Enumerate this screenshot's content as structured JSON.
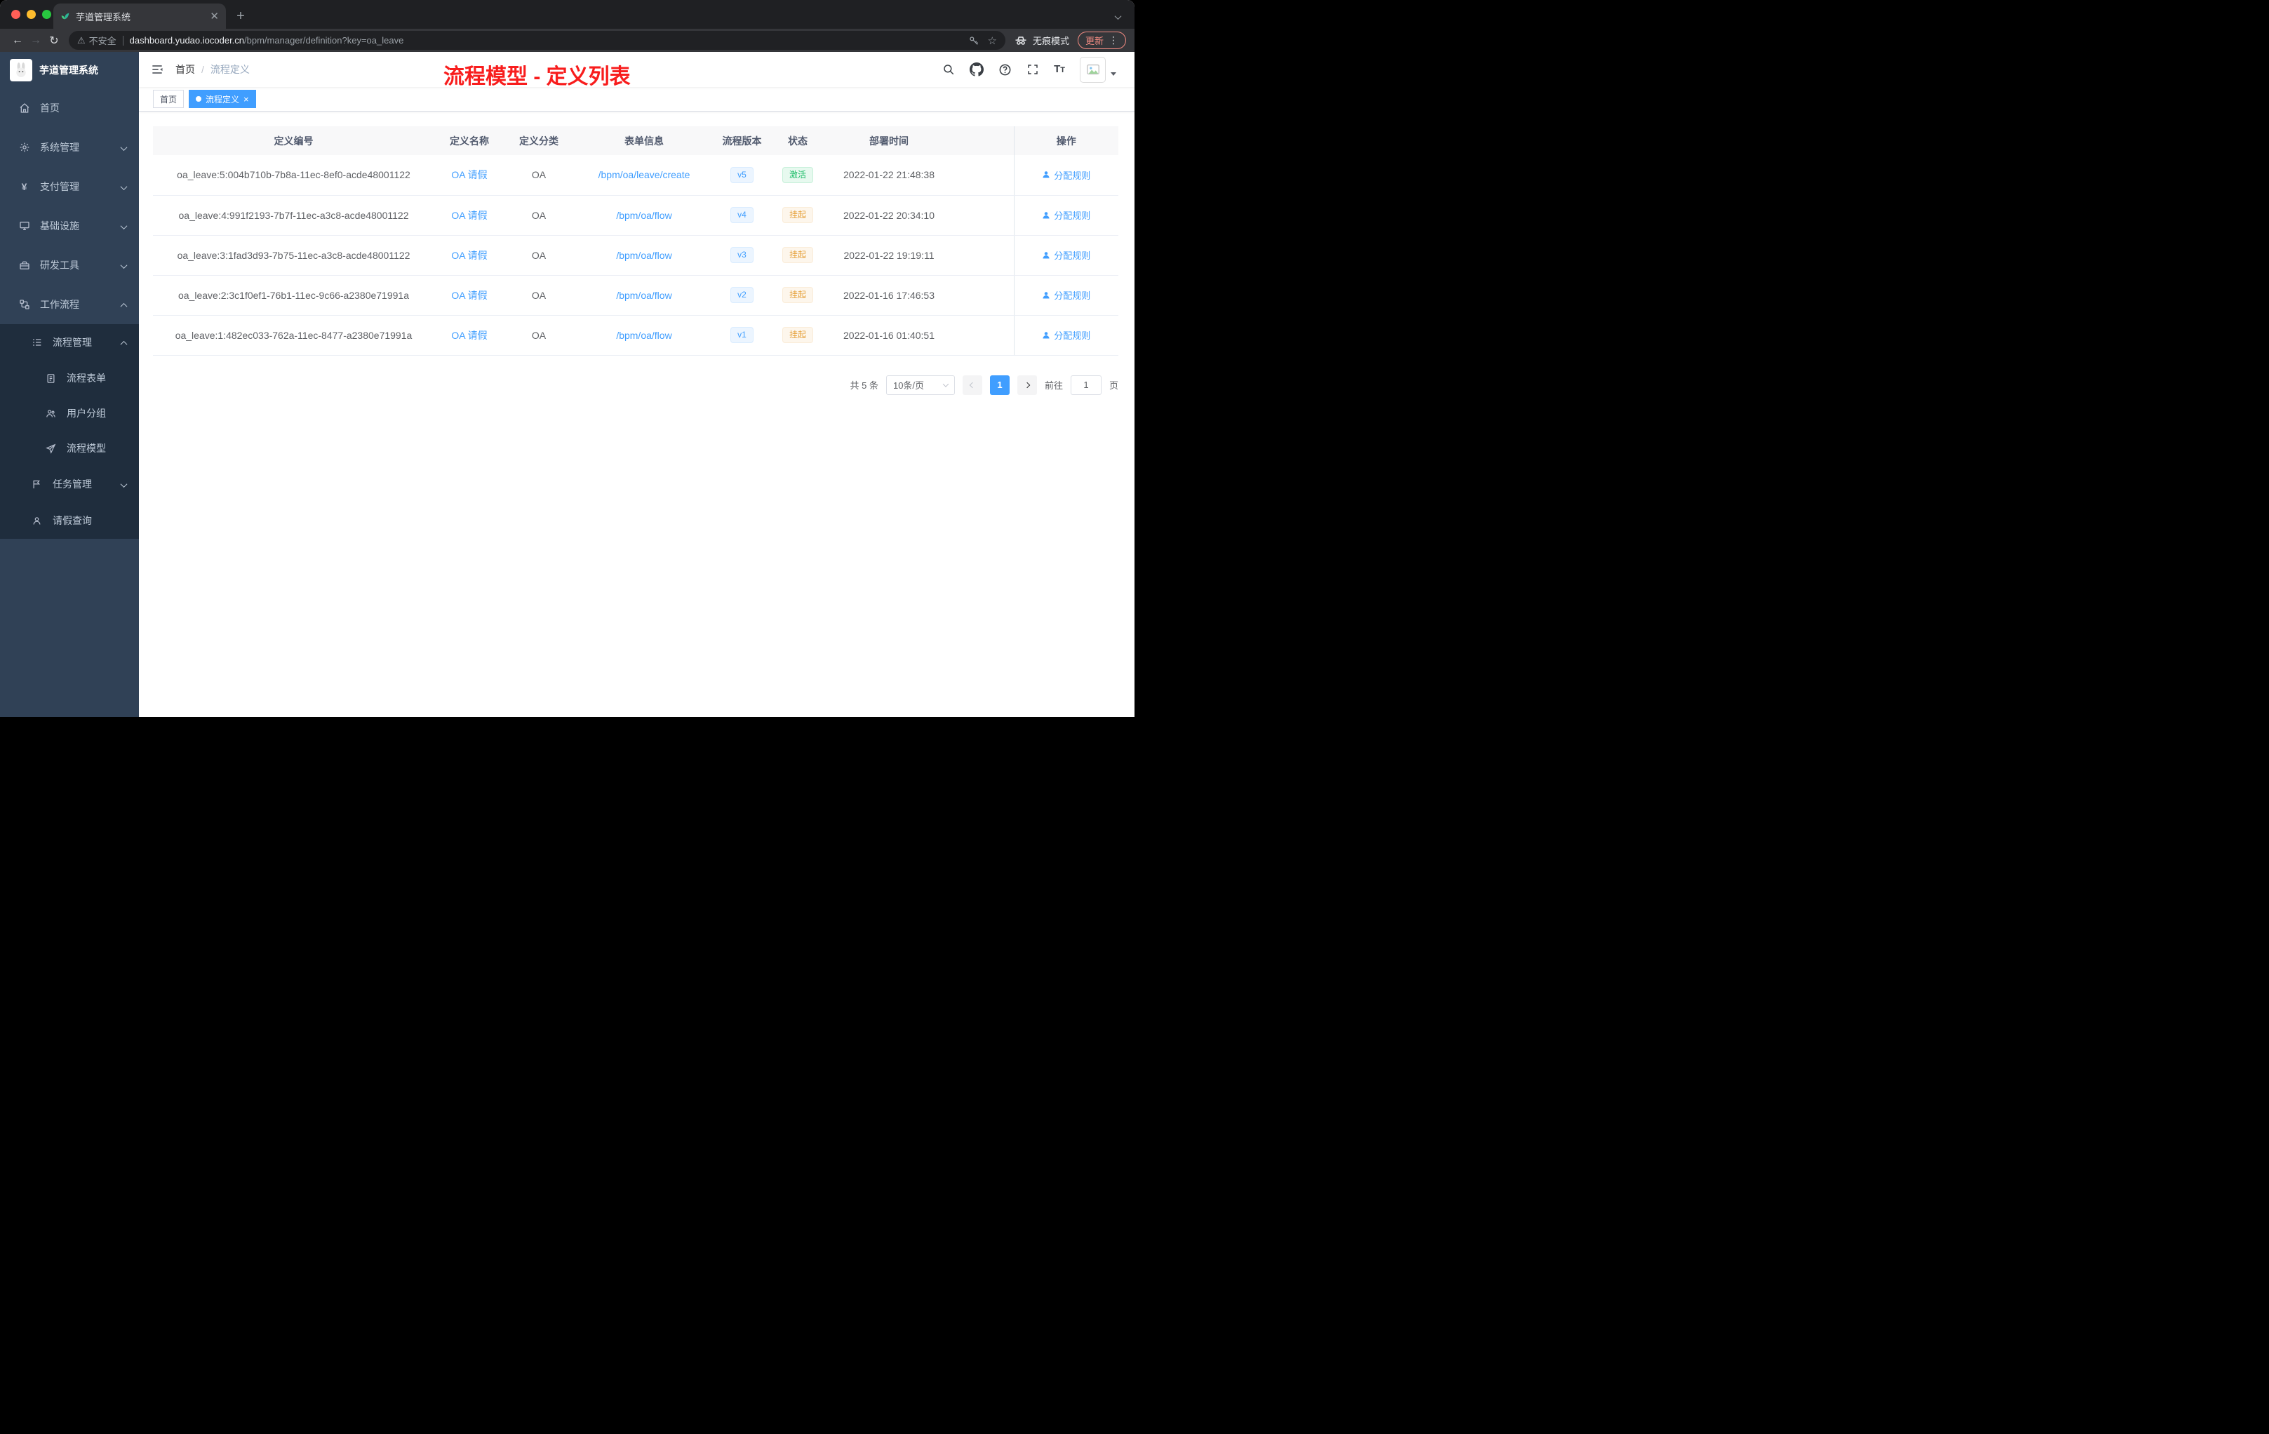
{
  "browser": {
    "tab_title": "芋道管理系统",
    "security_label": "不安全",
    "url_domain": "dashboard.yudao.iocoder.cn",
    "url_path": "/bpm/manager/definition?key=oa_leave",
    "incognito_label": "无痕模式",
    "update_label": "更新"
  },
  "sidebar": {
    "logo_title": "芋道管理系统",
    "items": [
      {
        "label": "首页"
      },
      {
        "label": "系统管理"
      },
      {
        "label": "支付管理"
      },
      {
        "label": "基础设施"
      },
      {
        "label": "研发工具"
      },
      {
        "label": "工作流程"
      },
      {
        "label": "流程管理"
      },
      {
        "label": "流程表单"
      },
      {
        "label": "用户分组"
      },
      {
        "label": "流程模型"
      },
      {
        "label": "任务管理"
      },
      {
        "label": "请假查询"
      }
    ]
  },
  "header": {
    "breadcrumb_home": "首页",
    "breadcrumb_sep": "/",
    "breadcrumb_current": "流程定义",
    "annotation": "流程模型 - 定义列表"
  },
  "tags": {
    "home": "首页",
    "current": "流程定义"
  },
  "table": {
    "columns": [
      "定义编号",
      "定义名称",
      "定义分类",
      "表单信息",
      "流程版本",
      "状态",
      "部署时间",
      "操作"
    ],
    "rows": [
      {
        "id": "oa_leave:5:004b710b-7b8a-11ec-8ef0-acde48001122",
        "name": "OA 请假",
        "category": "OA",
        "form": "/bpm/oa/leave/create",
        "version": "v5",
        "status": "激活",
        "time": "2022-01-22 21:48:38",
        "action": "分配规则"
      },
      {
        "id": "oa_leave:4:991f2193-7b7f-11ec-a3c8-acde48001122",
        "name": "OA 请假",
        "category": "OA",
        "form": "/bpm/oa/flow",
        "version": "v4",
        "status": "挂起",
        "time": "2022-01-22 20:34:10",
        "action": "分配规则"
      },
      {
        "id": "oa_leave:3:1fad3d93-7b75-11ec-a3c8-acde48001122",
        "name": "OA 请假",
        "category": "OA",
        "form": "/bpm/oa/flow",
        "version": "v3",
        "status": "挂起",
        "time": "2022-01-22 19:19:11",
        "action": "分配规则"
      },
      {
        "id": "oa_leave:2:3c1f0ef1-76b1-11ec-9c66-a2380e71991a",
        "name": "OA 请假",
        "category": "OA",
        "form": "/bpm/oa/flow",
        "version": "v2",
        "status": "挂起",
        "time": "2022-01-16 17:46:53",
        "action": "分配规则"
      },
      {
        "id": "oa_leave:1:482ec033-762a-11ec-8477-a2380e71991a",
        "name": "OA 请假",
        "category": "OA",
        "form": "/bpm/oa/flow",
        "version": "v1",
        "status": "挂起",
        "time": "2022-01-16 01:40:51",
        "action": "分配规则"
      }
    ]
  },
  "pagination": {
    "total": "共 5 条",
    "page_size": "10条/页",
    "current_page": "1",
    "goto_label": "前往",
    "goto_value": "1",
    "page_unit": "页"
  },
  "colors": {
    "accent": "#409eff",
    "success_text": "#1dbd68",
    "warning_text": "#e6a23c",
    "annotation_red": "#f81d1d",
    "sidebar_bg": "#304156",
    "submenu_bg": "#1f2d3d"
  }
}
